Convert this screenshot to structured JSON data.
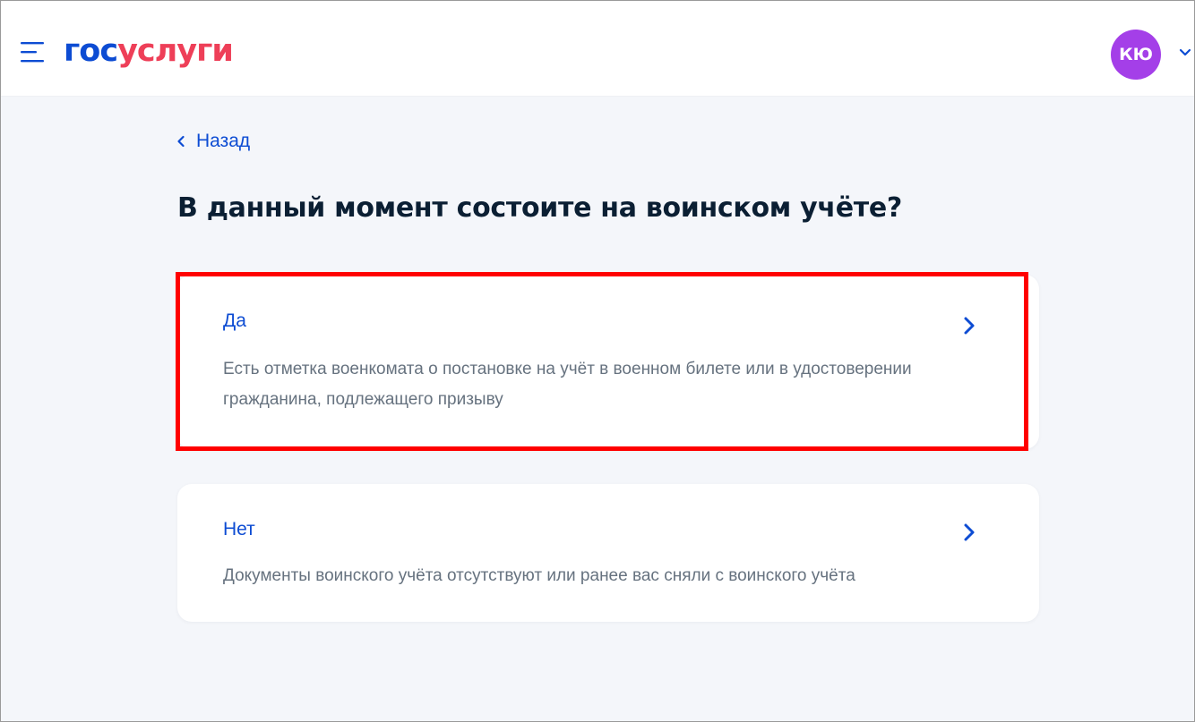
{
  "header": {
    "logo_part1": "гос",
    "logo_part2": "услуги",
    "avatar_initials": "КЮ",
    "menu_icon": "hamburger-menu-icon",
    "chevron_icon": "chevron-down-icon"
  },
  "back": {
    "label": "Назад",
    "icon": "chevron-left-icon"
  },
  "page": {
    "title": "В данный момент состоите на воинском учёте?"
  },
  "options": [
    {
      "title": "Да",
      "description": "Есть отметка военкомата о постановке на учёт в военном билете или в удостоверении гражданина, подлежащего призыву",
      "highlighted": true,
      "icon": "chevron-right-icon"
    },
    {
      "title": "Нет",
      "description": "Документы воинского учёта отсутствуют или ранее вас сняли с воинского учёта",
      "highlighted": false,
      "icon": "chevron-right-icon"
    }
  ],
  "colors": {
    "brand_blue": "#0d4cd3",
    "brand_red": "#ee3f58",
    "avatar": "#a43fe8",
    "highlight": "#ff0000",
    "page_background": "#f4f6fa",
    "title_text": "#0b1f33",
    "secondary_text": "#66727f"
  }
}
